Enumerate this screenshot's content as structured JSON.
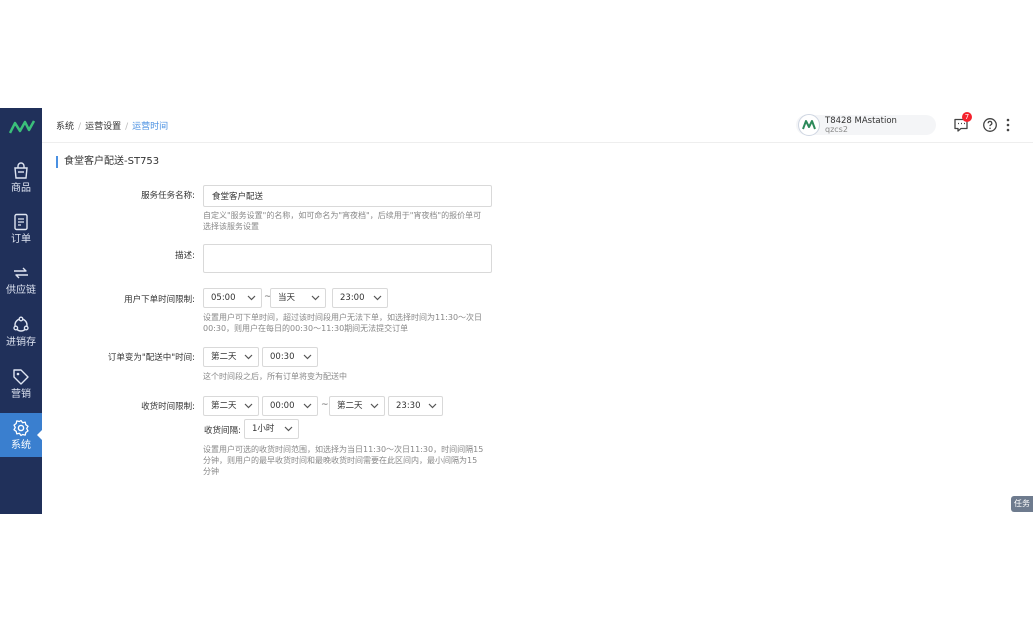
{
  "sidebar": {
    "items": [
      {
        "label": "商品",
        "icon": "shopping-bag-icon"
      },
      {
        "label": "订单",
        "icon": "document-icon"
      },
      {
        "label": "供应链",
        "icon": "exchange-icon"
      },
      {
        "label": "进销存",
        "icon": "inventory-icon"
      },
      {
        "label": "营销",
        "icon": "tag-icon"
      },
      {
        "label": "系统",
        "icon": "gear-icon"
      }
    ],
    "active": "系统"
  },
  "breadcrumb": {
    "items": [
      "系统",
      "运营设置",
      "运营时间"
    ]
  },
  "user": {
    "name": "T8428 MAstation",
    "sub": "qzcs2"
  },
  "notifications": {
    "count": "7"
  },
  "page": {
    "title": "食堂客户配送-ST753"
  },
  "form": {
    "service_name": {
      "label": "服务任务名称:",
      "value": "食堂客户配送",
      "hint1": "自定义\"服务设置\"的名称，如可命名为\"宵夜档\"，后续用于\"宵夜档\"的报价单可",
      "hint2": "选择该服务设置"
    },
    "description": {
      "label": "描述:",
      "value": ""
    },
    "order_time_limit": {
      "label": "用户下单时间限制:",
      "start": "05:00",
      "day": "当天",
      "end": "23:00",
      "tilde": "~",
      "hint1": "设置用户可下单时间，超过该时间段用户无法下单，如选择时间为11:30～次日",
      "hint2": "00:30，则用户在每日的00:30～11:30期间无法提交订单"
    },
    "delivery_status_time": {
      "label": "订单变为\"配送中\"时间:",
      "day": "第二天",
      "time": "00:30",
      "hint": "这个时间段之后，所有订单将变为配送中"
    },
    "receive_time_limit": {
      "label": "收货时间限制:",
      "start_day": "第二天",
      "start_time": "00:00",
      "end_day": "第二天",
      "end_time": "23:30",
      "tilde": "~",
      "interval_label": "收货间隔:",
      "interval": "1小时",
      "hint1": "设置用户可选的收货时间范围，如选择为当日11:30～次日11:30，时间间隔15",
      "hint2": "分钟，则用户的最早收货时间和最晚收货时间需要在此区间内，最小间隔为15",
      "hint3": "分钟"
    }
  },
  "task_button": {
    "label": "任务"
  },
  "colors": {
    "sidebar": "#20305a",
    "accent": "#3a7fcf",
    "badge": "#f5222d"
  }
}
